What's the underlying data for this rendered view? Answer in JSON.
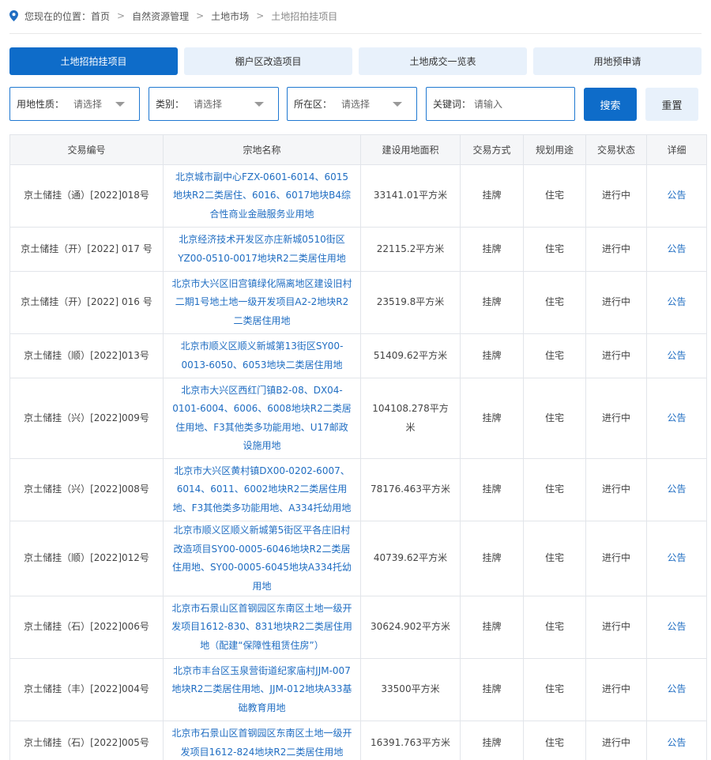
{
  "breadcrumb": {
    "prefix": "您现在的位置：",
    "items": [
      "首页",
      "自然资源管理",
      "土地市场",
      "土地招拍挂项目"
    ],
    "separator": ">"
  },
  "tabs": [
    {
      "label": "土地招拍挂项目",
      "active": true
    },
    {
      "label": "棚户区改造项目",
      "active": false
    },
    {
      "label": "土地成交一览表",
      "active": false
    },
    {
      "label": "用地预申请",
      "active": false
    }
  ],
  "filters": {
    "land_nature": {
      "label": "用地性质：",
      "value": "请选择"
    },
    "category": {
      "label": "类别：",
      "value": "请选择"
    },
    "district": {
      "label": "所在区：",
      "value": "请选择"
    },
    "keyword": {
      "label": "关键词：",
      "placeholder": "请输入"
    },
    "search_label": "搜索",
    "reset_label": "重置"
  },
  "table": {
    "headers": [
      "交易编号",
      "宗地名称",
      "建设用地面积",
      "交易方式",
      "规划用途",
      "交易状态",
      "详细"
    ],
    "rows": [
      {
        "code": "京土储挂（通）[2022]018号",
        "name": "北京城市副中心FZX-0601-6014、6015地块R2二类居住、6016、6017地块B4综合性商业金融服务业用地",
        "area": "33141.01平方米",
        "method": "挂牌",
        "use": "住宅",
        "status": "进行中",
        "detail": "公告"
      },
      {
        "code": "京土储挂（开）[2022] 017 号",
        "name": "北京经济技术开发区亦庄新城0510街区YZ00-0510-0017地块R2二类居住用地",
        "area": "22115.2平方米",
        "method": "挂牌",
        "use": "住宅",
        "status": "进行中",
        "detail": "公告"
      },
      {
        "code": "京土储挂（开）[2022] 016 号",
        "name": "北京市大兴区旧宫镇绿化隔离地区建设旧村二期1号地土地一级开发项目A2-2地块R2二类居住用地",
        "area": "23519.8平方米",
        "method": "挂牌",
        "use": "住宅",
        "status": "进行中",
        "detail": "公告"
      },
      {
        "code": "京土储挂（顺）[2022]013号",
        "name": "北京市顺义区顺义新城第13街区SY00-0013-6050、6053地块二类居住用地",
        "area": "51409.62平方米",
        "method": "挂牌",
        "use": "住宅",
        "status": "进行中",
        "detail": "公告"
      },
      {
        "code": "京土储挂（兴）[2022]009号",
        "name": "北京市大兴区西红门镇B2-08、DX04-0101-6004、6006、6008地块R2二类居住用地、F3其他类多功能用地、U17邮政设施用地",
        "area": "104108.278平方米",
        "method": "挂牌",
        "use": "住宅",
        "status": "进行中",
        "detail": "公告"
      },
      {
        "code": "京土储挂（兴）[2022]008号",
        "name": "北京市大兴区黄村镇DX00-0202-6007、6014、6011、6002地块R2二类居住用地、F3其他类多功能用地、A334托幼用地",
        "area": "78176.463平方米",
        "method": "挂牌",
        "use": "住宅",
        "status": "进行中",
        "detail": "公告"
      },
      {
        "code": "京土储挂（顺）[2022]012号",
        "name": "北京市顺义区顺义新城第5街区平各庄旧村改造项目SY00-0005-6046地块R2二类居住用地、SY00-0005-6045地块A334托幼用地",
        "area": "40739.62平方米",
        "method": "挂牌",
        "use": "住宅",
        "status": "进行中",
        "detail": "公告"
      },
      {
        "code": "京土储挂（石）[2022]006号",
        "name": "北京市石景山区首钢园区东南区土地一级开发项目1612-830、831地块R2二类居住用地（配建“保障性租赁住房”）",
        "area": "30624.902平方米",
        "method": "挂牌",
        "use": "住宅",
        "status": "进行中",
        "detail": "公告"
      },
      {
        "code": "京土储挂（丰）[2022]004号",
        "name": "北京市丰台区玉泉营街道纪家庙村JJM-007地块R2二类居住用地、JJM-012地块A33基础教育用地",
        "area": "33500平方米",
        "method": "挂牌",
        "use": "住宅",
        "status": "进行中",
        "detail": "公告"
      },
      {
        "code": "京土储挂（石）[2022]005号",
        "name": "北京市石景山区首钢园区东南区土地一级开发项目1612-824地块R2二类居住用地",
        "area": "16391.763平方米",
        "method": "挂牌",
        "use": "住宅",
        "status": "进行中",
        "detail": "公告"
      }
    ]
  },
  "colors": {
    "primary": "#0e6cc9",
    "link": "#1f6dc2",
    "tab_bg": "#e8f1fb"
  },
  "icons": {
    "location": "location-pin-icon",
    "dropdown": "chevron-down-icon"
  }
}
